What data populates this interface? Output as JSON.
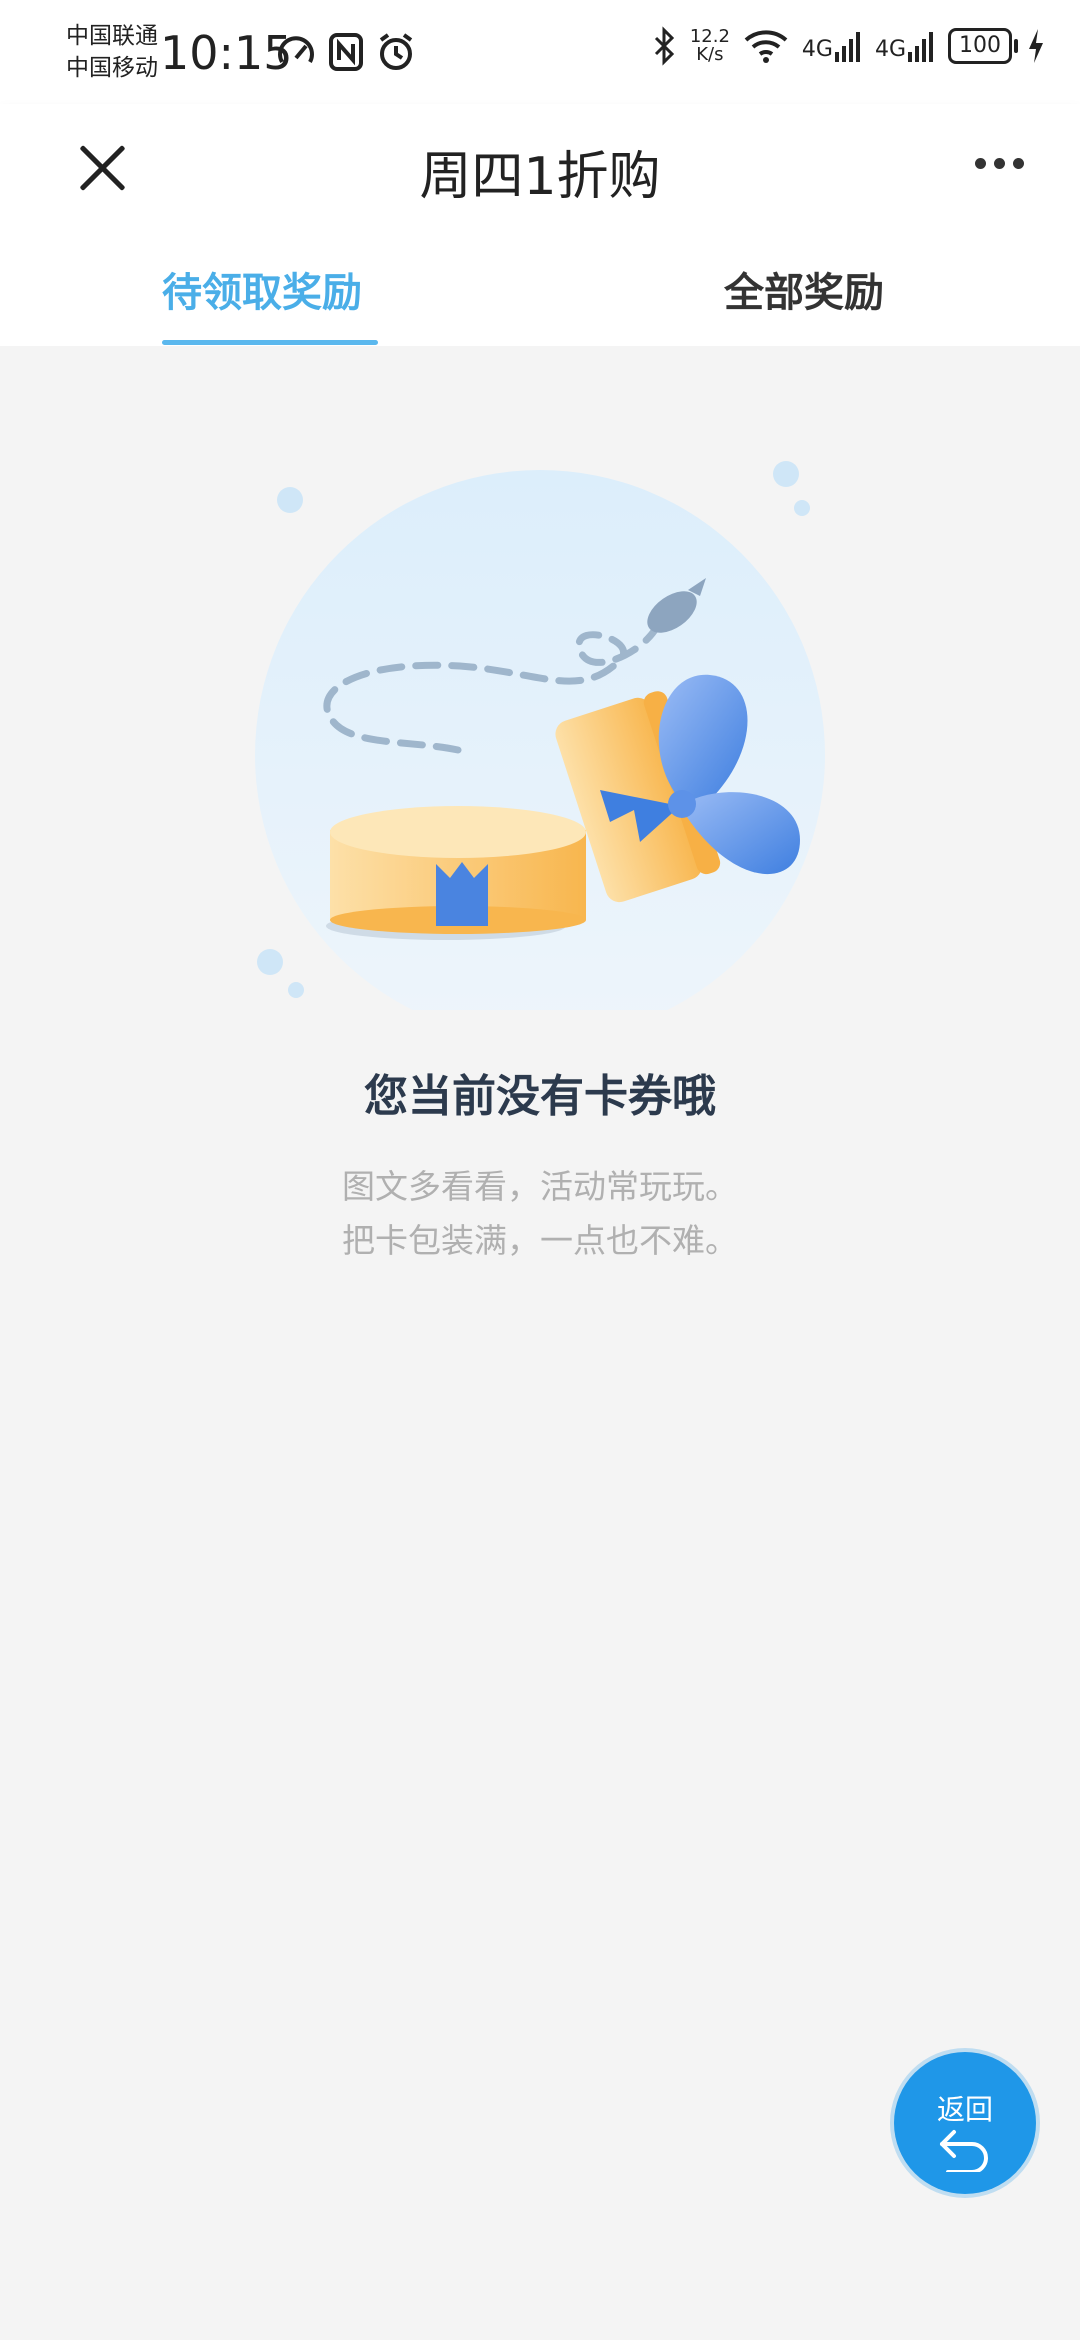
{
  "status_bar": {
    "carrier1": "中国联通",
    "carrier2": "中国移动",
    "time": "10:15",
    "net_speed_value": "12.2",
    "net_speed_unit": "K/s",
    "sig1_label": "4G",
    "sig2_label": "4G",
    "battery": "100"
  },
  "header": {
    "title": "周四1折购"
  },
  "tabs": [
    {
      "label": "待领取奖励",
      "active": true
    },
    {
      "label": "全部奖励",
      "active": false
    }
  ],
  "empty_state": {
    "title": "您当前没有卡券哦",
    "line1": "图文多看看，活动常玩玩。",
    "line2": "把卡包装满，一点也不难。"
  },
  "back_button": {
    "label": "返回"
  },
  "colors": {
    "accent": "#4aaee8",
    "fab": "#1f97e8",
    "background": "#f4f4f4"
  }
}
